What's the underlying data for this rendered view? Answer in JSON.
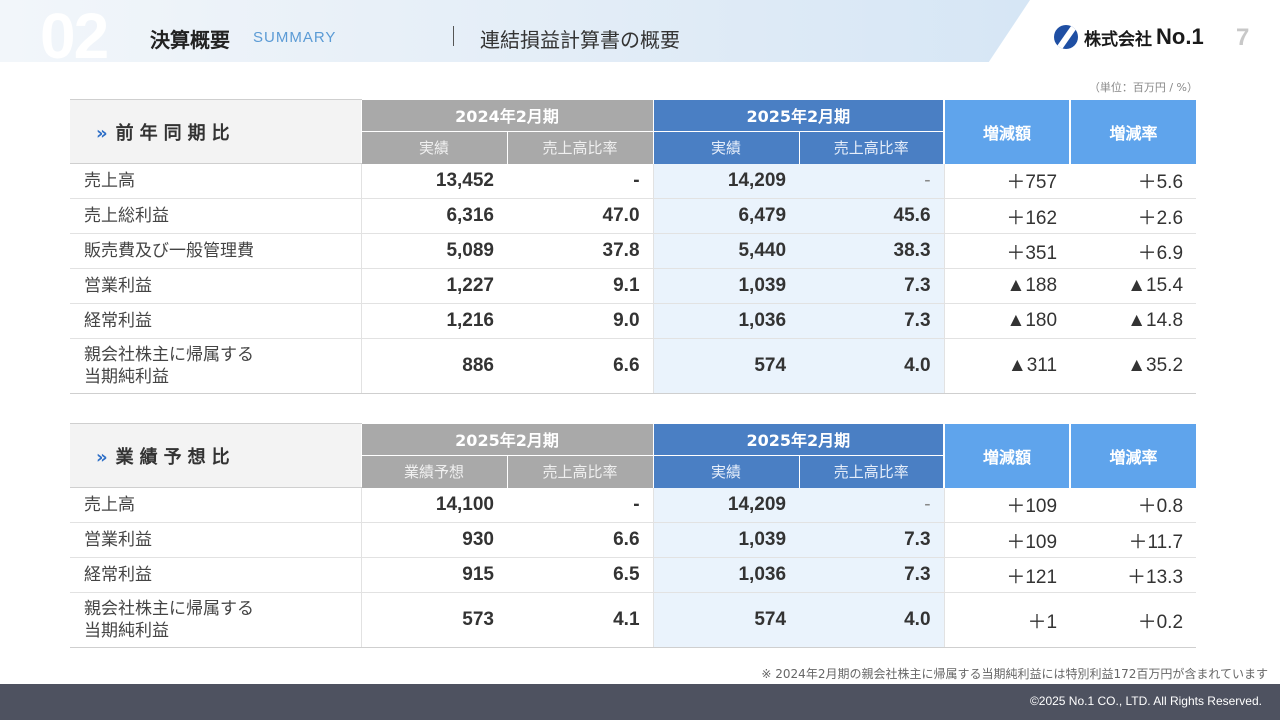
{
  "header": {
    "section_no": "02",
    "section_title": "決算概要",
    "section_sub": "SUMMARY",
    "page_heading": "連結損益計算書の概要",
    "logo_text": "株式会社",
    "logo_no": "No.1",
    "page_num": "7"
  },
  "unit_note": "（単位：百万円 / %）",
  "table1": {
    "label_chev": "»",
    "label": "前年同期比",
    "prev_period": "2024年2月期",
    "cur_period": "2025年2月期",
    "diff_amount": "増減額",
    "diff_rate": "増減率",
    "prev_cols": [
      "実績",
      "売上高比率"
    ],
    "cur_cols": [
      "実績",
      "売上高比率"
    ],
    "rows": [
      {
        "label": "売上高",
        "prev_val": "13,452",
        "prev_ratio": "-",
        "cur_val": "14,209",
        "cur_ratio": "-",
        "diff_amt": "＋757",
        "diff_rate": "＋5.6"
      },
      {
        "label": "売上総利益",
        "prev_val": "6,316",
        "prev_ratio": "47.0",
        "cur_val": "6,479",
        "cur_ratio": "45.6",
        "diff_amt": "＋162",
        "diff_rate": "＋2.6"
      },
      {
        "label": "販売費及び一般管理費",
        "prev_val": "5,089",
        "prev_ratio": "37.8",
        "cur_val": "5,440",
        "cur_ratio": "38.3",
        "diff_amt": "＋351",
        "diff_rate": "＋6.9"
      },
      {
        "label": "営業利益",
        "prev_val": "1,227",
        "prev_ratio": "9.1",
        "cur_val": "1,039",
        "cur_ratio": "7.3",
        "diff_amt": "▲188",
        "diff_rate": "▲15.4"
      },
      {
        "label": "経常利益",
        "prev_val": "1,216",
        "prev_ratio": "9.0",
        "cur_val": "1,036",
        "cur_ratio": "7.3",
        "diff_amt": "▲180",
        "diff_rate": "▲14.8"
      },
      {
        "label": "親会社株主に帰属する当期純利益",
        "label_l1": "親会社株主に帰属する",
        "label_l2": "当期純利益",
        "prev_val": "886",
        "prev_ratio": "6.6",
        "cur_val": "574",
        "cur_ratio": "4.0",
        "diff_amt": "▲311",
        "diff_rate": "▲35.2"
      }
    ]
  },
  "table2": {
    "label_chev": "»",
    "label": "業績予想比",
    "prev_period": "2025年2月期",
    "cur_period": "2025年2月期",
    "diff_amount": "増減額",
    "diff_rate": "増減率",
    "prev_cols": [
      "業績予想",
      "売上高比率"
    ],
    "cur_cols": [
      "実績",
      "売上高比率"
    ],
    "rows": [
      {
        "label": "売上高",
        "prev_val": "14,100",
        "prev_ratio": "-",
        "cur_val": "14,209",
        "cur_ratio": "-",
        "diff_amt": "＋109",
        "diff_rate": "＋0.8"
      },
      {
        "label": "営業利益",
        "prev_val": "930",
        "prev_ratio": "6.6",
        "cur_val": "1,039",
        "cur_ratio": "7.3",
        "diff_amt": "＋109",
        "diff_rate": "＋11.7"
      },
      {
        "label": "経常利益",
        "prev_val": "915",
        "prev_ratio": "6.5",
        "cur_val": "1,036",
        "cur_ratio": "7.3",
        "diff_amt": "＋121",
        "diff_rate": "＋13.3"
      },
      {
        "label": "親会社株主に帰属する当期純利益",
        "label_l1": "親会社株主に帰属する",
        "label_l2": "当期純利益",
        "prev_val": "573",
        "prev_ratio": "4.1",
        "cur_val": "574",
        "cur_ratio": "4.0",
        "diff_amt": "＋1",
        "diff_rate": "＋0.2"
      }
    ]
  },
  "footnote": "※ 2024年2月期の親会社株主に帰属する当期純利益には特別利益172百万円が含まれています",
  "copyright": "©2025 No.1 CO., LTD. All Rights Reserved."
}
